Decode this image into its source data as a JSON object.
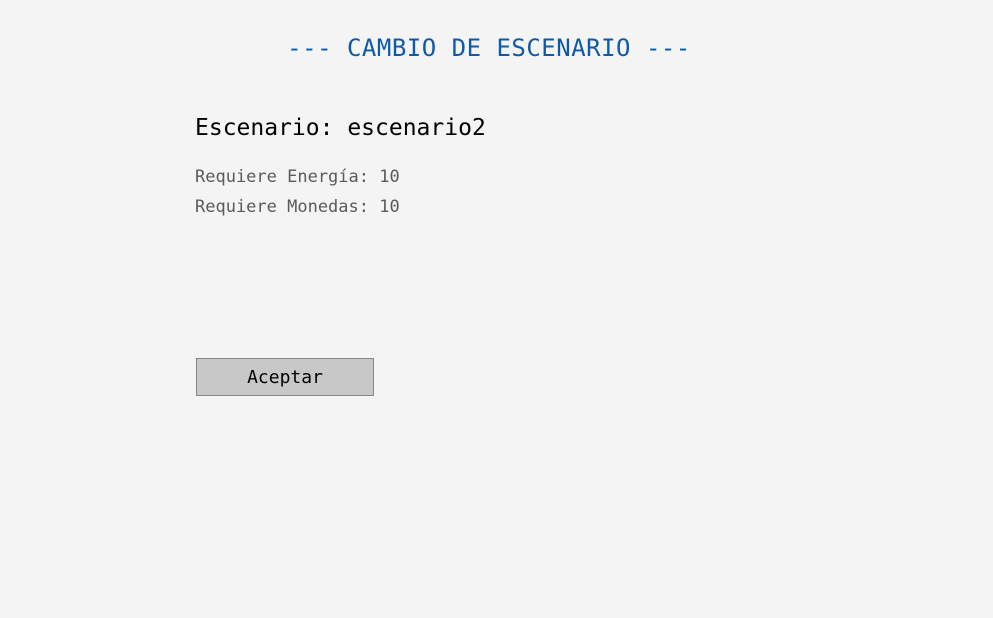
{
  "title": "--- CAMBIO DE ESCENARIO ---",
  "scenario": {
    "label": "Escenario: escenario2"
  },
  "requirements": {
    "energy": "Requiere Energía: 10",
    "coins": "Requiere Monedas: 10"
  },
  "buttons": {
    "accept": "Aceptar"
  },
  "colors": {
    "background": "#f4f4f4",
    "title": "#0e5aa8",
    "button": "#c8c8c8"
  }
}
